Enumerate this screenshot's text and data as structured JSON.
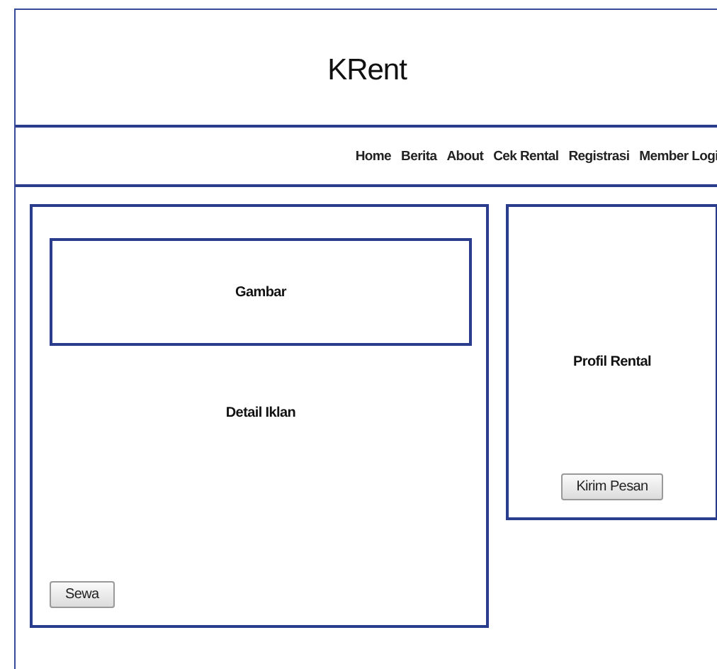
{
  "header": {
    "title": "KRent"
  },
  "nav": [
    {
      "label": "Home"
    },
    {
      "label": "Berita"
    },
    {
      "label": "About"
    },
    {
      "label": "Cek Rental"
    },
    {
      "label": "Registrasi"
    },
    {
      "label": "Member Logi"
    }
  ],
  "ad_panel": {
    "image_label": "Gambar",
    "detail_label": "Detail Iklan",
    "button": "Sewa"
  },
  "profile_panel": {
    "label": "Profil Rental",
    "button": "Kirim Pesan"
  }
}
